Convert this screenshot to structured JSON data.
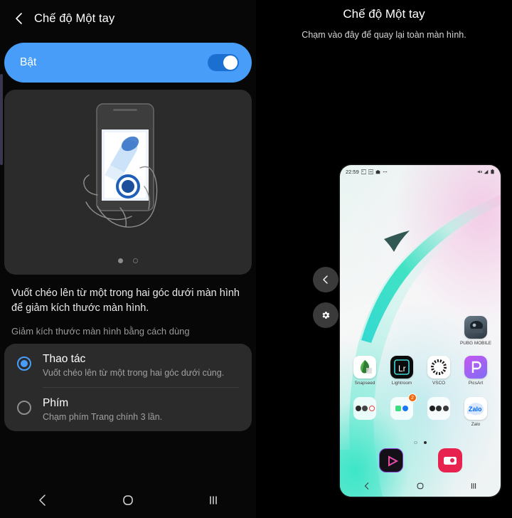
{
  "left": {
    "header": {
      "back_icon": "back-chevron-icon",
      "title": "Chế độ Một tay"
    },
    "toggle": {
      "label": "Bật",
      "state": "on",
      "color": "#479df7"
    },
    "illustration": {
      "name": "one-handed-gesture-illustration",
      "page_dots": [
        "filled",
        "outlined"
      ]
    },
    "description": {
      "main": "Vuốt chéo lên từ một trong hai góc dưới màn hình để giảm kích thước màn hình.",
      "sub": "Giảm kích thước màn hình bằng cách dùng"
    },
    "options": [
      {
        "title": "Thao tác",
        "subtitle": "Vuốt chéo lên từ một trong hai góc dưới cùng.",
        "selected": true
      },
      {
        "title": "Phím",
        "subtitle": "Chạm phím Trang chính 3 lần.",
        "selected": false
      }
    ],
    "navbar": [
      {
        "name": "back-nav-button",
        "icon": "chevron-left-icon"
      },
      {
        "name": "home-nav-button",
        "icon": "circle-icon"
      },
      {
        "name": "recents-nav-button",
        "icon": "three-bars-icon"
      }
    ]
  },
  "right": {
    "title": "Chế độ Một tay",
    "subtitle": "Chạm vào đây để quay lại toàn màn hình.",
    "side_buttons": [
      {
        "name": "collapse-back-button",
        "icon": "chevron-left-icon"
      },
      {
        "name": "settings-button",
        "icon": "gear-icon"
      }
    ],
    "mini_phone": {
      "status_bar": {
        "time": "22:59",
        "left_icons": [
          "image-icon",
          "screenshot-icon",
          "bag-icon",
          "more-dots-icon"
        ],
        "right_icons": [
          "mute-icon",
          "signal-icon",
          "battery-icon"
        ]
      },
      "apps_row1": [
        {
          "label": "PUBG MOBILE",
          "icon": "pubg-mobile-icon",
          "color": "#3b4754"
        }
      ],
      "apps_row2": [
        {
          "label": "Snapseed",
          "icon": "snapseed-icon",
          "color": "#ffffff"
        },
        {
          "label": "Lightroom",
          "icon": "lightroom-icon",
          "color": "#0a0a0a"
        },
        {
          "label": "VSCO",
          "icon": "vsco-icon",
          "color": "#ffffff"
        },
        {
          "label": "PicsArt",
          "icon": "picsart-icon",
          "color": "#b03cf0"
        }
      ],
      "folders_row": [
        {
          "label": "",
          "icon": "folder-icon",
          "badge": ""
        },
        {
          "label": "",
          "icon": "folder-social-icon",
          "badge": "2"
        },
        {
          "label": "",
          "icon": "folder-dark-icon",
          "badge": ""
        },
        {
          "label": "Zalo",
          "icon": "zalo-icon",
          "color": "#0068ff"
        }
      ],
      "page_dots": [
        "outlined",
        "filled"
      ],
      "dock": [
        {
          "icon": "video-player-icon"
        },
        {
          "icon": "camera-icon"
        }
      ],
      "navbar": [
        {
          "icon": "chevron-left-icon"
        },
        {
          "icon": "circle-icon"
        },
        {
          "icon": "three-bars-icon"
        }
      ]
    }
  }
}
